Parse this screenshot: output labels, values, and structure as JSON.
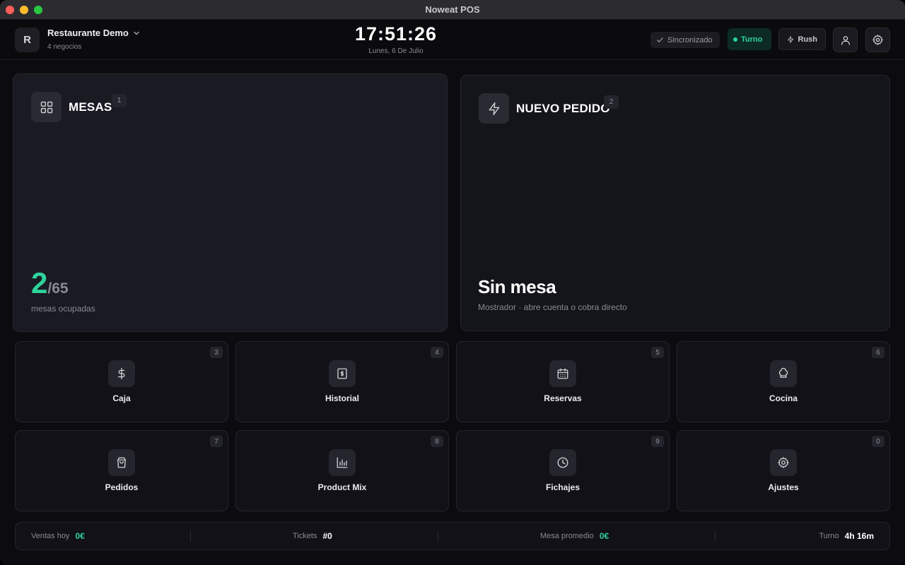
{
  "window": {
    "title": "Noweat POS"
  },
  "header": {
    "business_initial": "R",
    "business_name": "Restaurante Demo",
    "business_sub": "4 negocios",
    "clock": "17:51:26",
    "date": "Lunes, 6 De Julio",
    "sync_label": "Sincronizado",
    "turno_label": "Turno",
    "rush_label": "Rush"
  },
  "cards": {
    "mesas": {
      "title": "MESAS",
      "shortcut": "1",
      "occupied": "2",
      "total": "/65",
      "caption": "mesas ocupadas"
    },
    "pedido": {
      "title": "NUEVO PEDIDO",
      "shortcut": "2",
      "headline": "Sin mesa",
      "caption": "Mostrador · abre cuenta o cobra directo"
    }
  },
  "tiles": [
    {
      "label": "Caja",
      "shortcut": "3",
      "icon": "dollar-icon"
    },
    {
      "label": "Historial",
      "shortcut": "4",
      "icon": "receipt-icon"
    },
    {
      "label": "Reservas",
      "shortcut": "5",
      "icon": "calendar-icon"
    },
    {
      "label": "Cocina",
      "shortcut": "6",
      "icon": "chef-hat-icon"
    },
    {
      "label": "Pedidos",
      "shortcut": "7",
      "icon": "shopping-bag-icon"
    },
    {
      "label": "Product Mix",
      "shortcut": "8",
      "icon": "bar-chart-icon"
    },
    {
      "label": "Fichajes",
      "shortcut": "9",
      "icon": "clock-icon"
    },
    {
      "label": "Ajustes",
      "shortcut": "0",
      "icon": "gear-icon"
    }
  ],
  "stats": {
    "ventas_label": "Ventas hoy",
    "ventas_value": "0€",
    "tickets_label": "Tickets",
    "tickets_value": "#0",
    "mesa_label": "Mesa promedio",
    "mesa_value": "0€",
    "turno_label": "Turno",
    "turno_value": "4h 16m"
  },
  "colors": {
    "accent": "#2ed39b",
    "background": "#0c0c10",
    "card": "#1a1a23"
  }
}
